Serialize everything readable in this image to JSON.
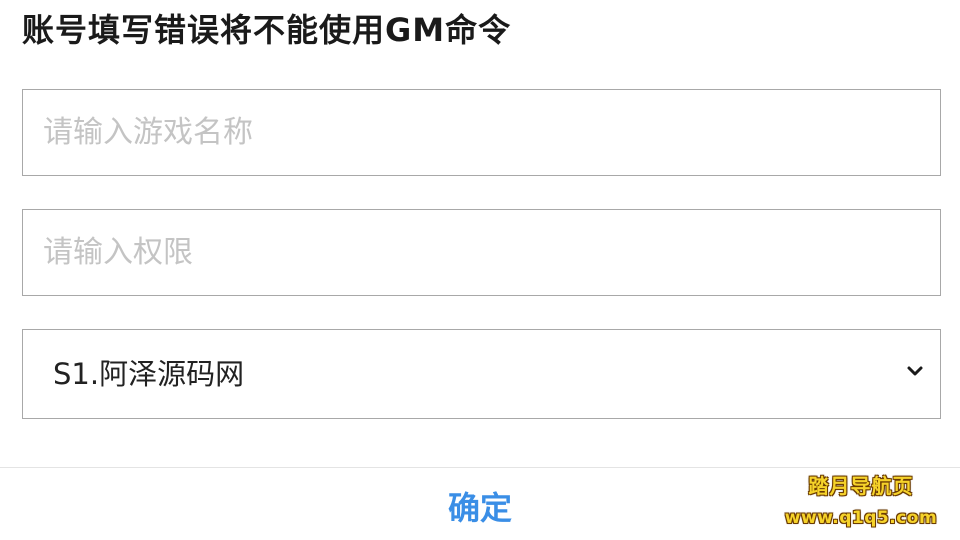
{
  "dialog": {
    "warning": "账号填写错误将不能使用GM命令",
    "game_name_input": {
      "value": "",
      "placeholder": "请输入游戏名称"
    },
    "permission_input": {
      "value": "",
      "placeholder": "请输入权限"
    },
    "server_select": {
      "selected": "S1.阿泽源码网",
      "icon": "chevron-down-icon"
    },
    "confirm_label": "确定"
  },
  "watermark": {
    "name": "踏月导航页",
    "url": "www.q1q5.com"
  },
  "colors": {
    "title_text": "#1a1a1a",
    "field_border": "#a8a8a8",
    "placeholder": "#c4c4c4",
    "confirm_text": "#3a8ee6",
    "watermark_fill": "#f6d32a",
    "watermark_outline": "#6b3b00"
  }
}
